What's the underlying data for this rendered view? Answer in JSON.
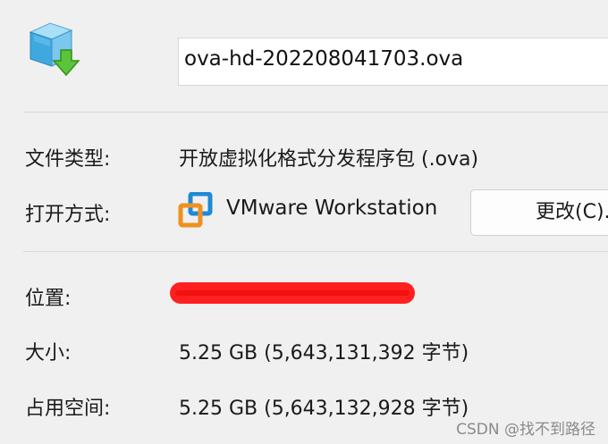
{
  "header": {
    "file_icon": "ova-package-download-icon",
    "filename": "ova-hd-202208041703.ova"
  },
  "details": {
    "file_type": {
      "label": "文件类型:",
      "value": "开放虚拟化格式分发程序包 (.ova)"
    },
    "opens_with": {
      "label": "打开方式:",
      "app_icon": "vmware-icon",
      "app_name": "VMware Workstation",
      "change_button": "更改(C)..."
    },
    "location": {
      "label": "位置:",
      "value_redacted": true
    },
    "size": {
      "label": "大小:",
      "value": "5.25 GB (5,643,131,392 字节)"
    },
    "size_on_disk": {
      "label": "占用空间:",
      "value": "5.25 GB (5,643,132,928 字节)"
    }
  },
  "watermark": "CSDN @找不到路径",
  "colors": {
    "background": "#f0f0f0",
    "redaction": "#ff2020",
    "vmware_orange": "#f0901e",
    "vmware_blue": "#1e8ad6"
  }
}
